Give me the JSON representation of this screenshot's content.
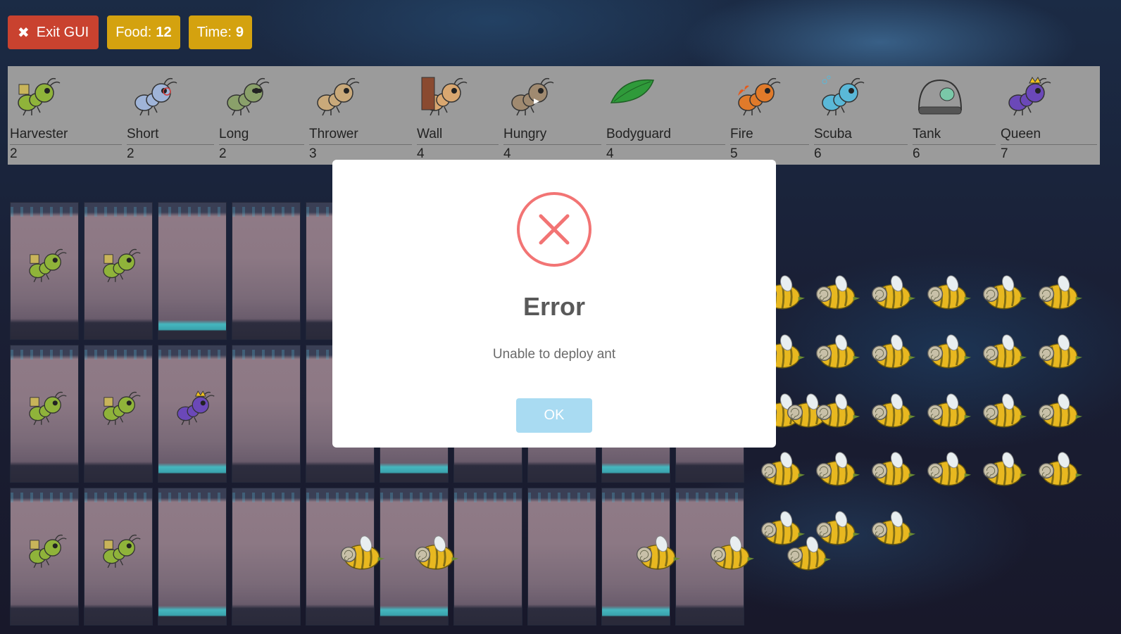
{
  "controls": {
    "exit_label": "Exit GUI",
    "food_label": "Food:",
    "food_value": "12",
    "time_label": "Time:",
    "time_value": "9"
  },
  "ant_types": [
    {
      "name": "Harvester",
      "cost": "2",
      "icon": "harvester-ant-icon",
      "color": "#8fb33a"
    },
    {
      "name": "Short",
      "cost": "2",
      "icon": "short-thrower-ant-icon",
      "color": "#9fb4d8"
    },
    {
      "name": "Long",
      "cost": "2",
      "icon": "long-thrower-ant-icon",
      "color": "#8aa06a"
    },
    {
      "name": "Thrower",
      "cost": "3",
      "icon": "thrower-ant-icon",
      "color": "#c9a97a"
    },
    {
      "name": "Wall",
      "cost": "4",
      "icon": "wall-ant-icon",
      "color": "#d9a770"
    },
    {
      "name": "Hungry",
      "cost": "4",
      "icon": "hungry-ant-icon",
      "color": "#a08a70"
    },
    {
      "name": "Bodyguard",
      "cost": "4",
      "icon": "bodyguard-ant-icon",
      "color": "#2f8f2f"
    },
    {
      "name": "Fire",
      "cost": "5",
      "icon": "fire-ant-icon",
      "color": "#e07a2a"
    },
    {
      "name": "Scuba",
      "cost": "6",
      "icon": "scuba-ant-icon",
      "color": "#5ab8d8"
    },
    {
      "name": "Tank",
      "cost": "6",
      "icon": "tank-ant-icon",
      "color": "#8a8a8a"
    },
    {
      "name": "Queen",
      "cost": "7",
      "icon": "queen-ant-icon",
      "color": "#6b48b8"
    }
  ],
  "dialog": {
    "icon": "error-x-icon",
    "title": "Error",
    "message": "Unable to deploy ant",
    "ok_label": "OK",
    "accent": "#f27474",
    "button_color": "#a9dbf2"
  }
}
